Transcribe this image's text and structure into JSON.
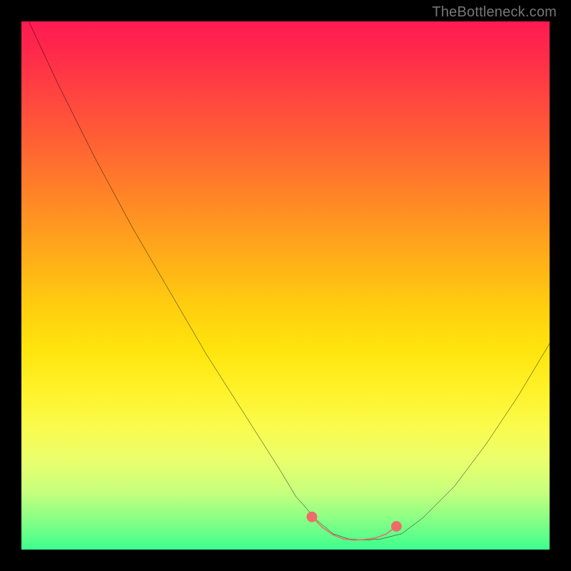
{
  "watermark": "TheBottleneck.com",
  "chart_data": {
    "type": "line",
    "title": "",
    "xlabel": "",
    "ylabel": "",
    "xlim": [
      0,
      100
    ],
    "ylim": [
      0,
      100
    ],
    "series": [
      {
        "name": "black-curve",
        "color": "#000000",
        "x": [
          0,
          7,
          14,
          21,
          28,
          35,
          42,
          49,
          52,
          56,
          59,
          62,
          65,
          68,
          72,
          76,
          82,
          88,
          94,
          100
        ],
        "y": [
          103,
          88,
          74,
          61,
          49,
          37,
          26,
          15,
          10,
          5.5,
          3,
          2,
          1.8,
          2,
          3,
          6,
          12,
          20,
          29,
          39
        ]
      },
      {
        "name": "salmon-highlight",
        "color": "#f06a6a",
        "x": [
          55,
          57,
          59,
          61,
          63,
          65,
          67,
          69,
          71
        ],
        "y": [
          6.2,
          4.2,
          2.8,
          2.0,
          1.8,
          1.9,
          2.2,
          2.9,
          4.4
        ]
      }
    ],
    "highlight_endpoints": [
      {
        "series": "salmon-highlight",
        "x": 55,
        "y": 6.2
      },
      {
        "series": "salmon-highlight",
        "x": 71,
        "y": 4.4
      }
    ],
    "background_gradient": {
      "stops": [
        {
          "pos": 0,
          "color": "#ff1a52"
        },
        {
          "pos": 6,
          "color": "#ff2a4a"
        },
        {
          "pos": 14,
          "color": "#ff4440"
        },
        {
          "pos": 22,
          "color": "#ff5e35"
        },
        {
          "pos": 30,
          "color": "#ff7a2b"
        },
        {
          "pos": 38,
          "color": "#ff9621"
        },
        {
          "pos": 46,
          "color": "#ffb217"
        },
        {
          "pos": 54,
          "color": "#ffce0f"
        },
        {
          "pos": 62,
          "color": "#ffe40c"
        },
        {
          "pos": 70,
          "color": "#fff22a"
        },
        {
          "pos": 77,
          "color": "#f9fb4e"
        },
        {
          "pos": 83,
          "color": "#eaff6c"
        },
        {
          "pos": 89,
          "color": "#c8ff7d"
        },
        {
          "pos": 94,
          "color": "#8cff85"
        },
        {
          "pos": 100,
          "color": "#3dff8d"
        }
      ]
    }
  }
}
